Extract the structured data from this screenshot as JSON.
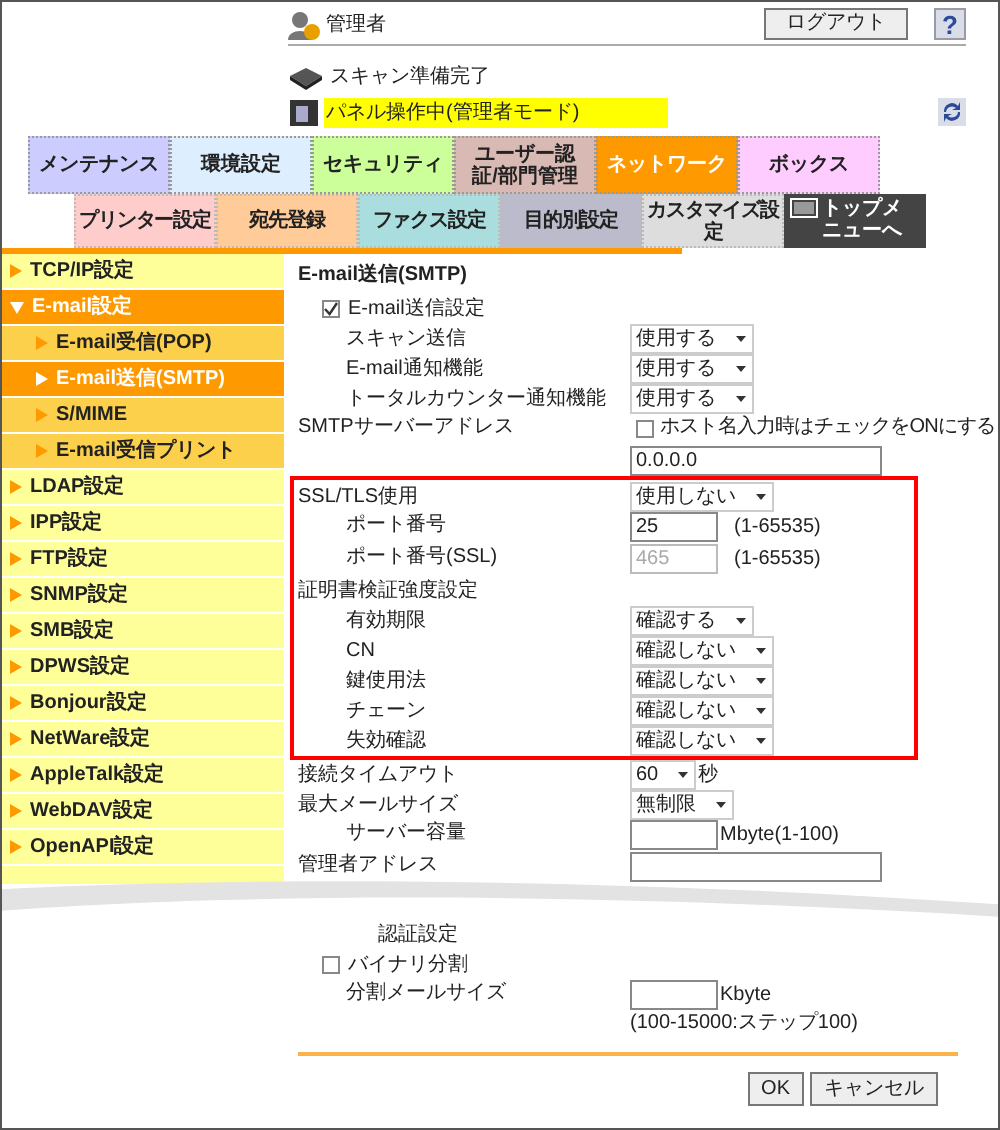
{
  "header": {
    "user": "管理者",
    "logout_button": "ログアウト",
    "help_button": "?",
    "status": [
      {
        "kind": "scanner",
        "text": "スキャン準備完了",
        "highlighted": false
      },
      {
        "kind": "panel",
        "text": "パネル操作中(管理者モード)",
        "highlighted": true
      }
    ]
  },
  "main_tabs": [
    {
      "label": "メンテナンス",
      "color": "#ccccff",
      "selected": false
    },
    {
      "label": "環境設定",
      "color": "#ddeeff",
      "selected": false
    },
    {
      "label": "セキュリティ",
      "color": "#ccff99",
      "selected": false
    },
    {
      "label": "ユーザー認証/部門管理",
      "color": "#d9b9b3",
      "selected": false
    },
    {
      "label": "ネットワーク",
      "color": "#ff9900",
      "selected": true
    },
    {
      "label": "ボックス",
      "color": "#ffccff",
      "selected": false
    }
  ],
  "sub_tabs": [
    {
      "label": "プリンター設定",
      "color": "#ffcccc",
      "kind": "tab",
      "selected": false
    },
    {
      "label": "宛先登録",
      "color": "#ffcc99",
      "kind": "tab",
      "selected": false
    },
    {
      "label": "ファクス設定",
      "color": "#aadddd",
      "kind": "tab",
      "selected": false
    },
    {
      "label": "目的別設定",
      "color": "#bbbbcc",
      "kind": "tab",
      "selected": false
    },
    {
      "label": "カスタマイズ設定",
      "color": "#dddddd",
      "kind": "tab",
      "selected": false
    },
    {
      "label": "トップメニューへ",
      "color": "#444444",
      "kind": "menu",
      "selected": false
    }
  ],
  "sidebar": {
    "items": [
      {
        "label": "TCP/IP設定",
        "selected": false
      },
      {
        "label": "E-mail設定",
        "selected": true,
        "expanded": true,
        "children": [
          {
            "label": "E-mail受信(POP)",
            "selected": false
          },
          {
            "label": "E-mail送信(SMTP)",
            "selected": true
          },
          {
            "label": "S/MIME",
            "selected": false
          },
          {
            "label": "E-mail受信プリント",
            "selected": false
          }
        ]
      },
      {
        "label": "LDAP設定",
        "selected": false
      },
      {
        "label": "IPP設定",
        "selected": false
      },
      {
        "label": "FTP設定",
        "selected": false
      },
      {
        "label": "SNMP設定",
        "selected": false
      },
      {
        "label": "SMB設定",
        "selected": false
      },
      {
        "label": "DPWS設定",
        "selected": false
      },
      {
        "label": "Bonjour設定",
        "selected": false
      },
      {
        "label": "NetWare設定",
        "selected": false
      },
      {
        "label": "AppleTalk設定",
        "selected": false
      },
      {
        "label": "WebDAV設定",
        "selected": false
      },
      {
        "label": "OpenAPI設定",
        "selected": false
      }
    ]
  },
  "form": {
    "title": "E-mail送信(SMTP)",
    "rows": [
      {
        "kind": "checkbox",
        "label": "E-mail送信設定",
        "checked": true,
        "children": [
          {
            "kind": "select",
            "label": "スキャン送信",
            "value": "使用する"
          },
          {
            "kind": "select",
            "label": "E-mail通知機能",
            "value": "使用する"
          },
          {
            "kind": "select",
            "label": "トータルカウンター通知機能",
            "value": "使用する"
          }
        ]
      },
      {
        "kind": "address",
        "label": "SMTPサーバーアドレス",
        "option": "ホスト名入力時はチェックをONにする",
        "checked": false,
        "value": "0.0.0.0"
      },
      {
        "kind": "group",
        "highlighted": true,
        "children": [
          {
            "kind": "select",
            "label": "SSL/TLS使用",
            "value": "使用しない",
            "children": [
              {
                "kind": "number-input",
                "label": "ポート番号",
                "value": "25",
                "hint": "(1-65535)",
                "disabled": false
              },
              {
                "kind": "number-input",
                "label": "ポート番号(SSL)",
                "value": "465",
                "hint": "(1-65535)",
                "disabled": true
              }
            ]
          },
          {
            "kind": "heading",
            "label": "証明書検証強度設定",
            "children": [
              {
                "kind": "select",
                "label": "有効期限",
                "value": "確認する"
              },
              {
                "kind": "select",
                "label": "CN",
                "value": "確認しない"
              },
              {
                "kind": "select",
                "label": "鍵使用法",
                "value": "確認しない"
              },
              {
                "kind": "select",
                "label": "チェーン",
                "value": "確認しない"
              },
              {
                "kind": "select",
                "label": "失効確認",
                "value": "確認しない"
              }
            ]
          }
        ]
      },
      {
        "kind": "select",
        "label": "接続タイムアウト",
        "value": "60",
        "unit": "秒"
      },
      {
        "kind": "select",
        "label": "最大メールサイズ",
        "value": "無制限",
        "children": [
          {
            "kind": "number-input",
            "label": "サーバー容量",
            "hint": "Mbyte(1-100)",
            "disabled": false
          }
        ]
      },
      {
        "kind": "address-input",
        "label": "管理者アドレス"
      }
    ],
    "rows_after_break": [
      {
        "kind": "sublabel",
        "label": "認証設定"
      },
      {
        "kind": "checkbox",
        "label": "バイナリ分割",
        "checked": false,
        "children": [
          {
            "kind": "number-input",
            "label": "分割メールサイズ",
            "hint": "Kbyte",
            "note": "(100-15000:ステップ100)",
            "disabled": false
          }
        ]
      }
    ]
  },
  "buttons": [
    "OK",
    "キャンセル"
  ]
}
